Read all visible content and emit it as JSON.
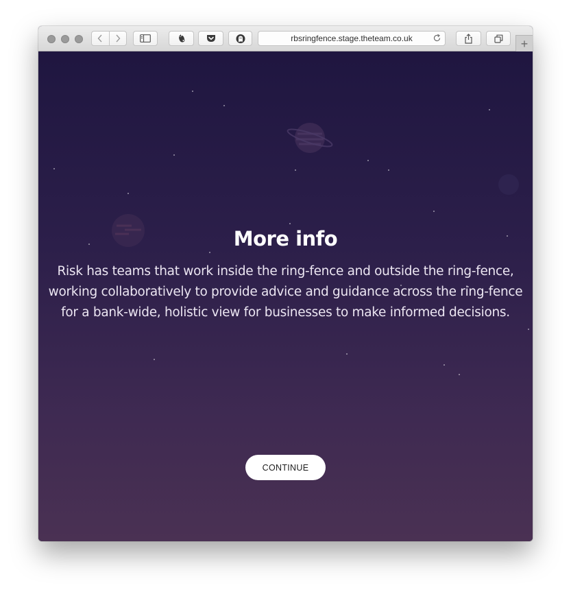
{
  "browser": {
    "url": "rbsringfence.stage.theteam.co.uk",
    "new_tab_symbol": "+"
  },
  "icons": {
    "back": "chevron-left-icon",
    "forward": "chevron-right-icon",
    "sidebar": "sidebar-icon",
    "extension": "evernote-icon",
    "pocket": "pocket-icon",
    "ghostery": "ghostery-icon",
    "reload": "reload-icon",
    "share": "share-icon",
    "tabs": "tabs-overview-icon"
  },
  "page": {
    "heading": "More info",
    "body": "Risk has teams that work inside the ring-fence and outside the ring-fence, working collaboratively to provide advice and guidance across the ring-fence for a bank-wide, holistic view for businesses to make informed decisions.",
    "continue_label": "CONTINUE"
  },
  "colors": {
    "background_top": "#1f1640",
    "background_bottom": "#4a3153",
    "text": "#ffffff",
    "button_bg": "#ffffff"
  }
}
